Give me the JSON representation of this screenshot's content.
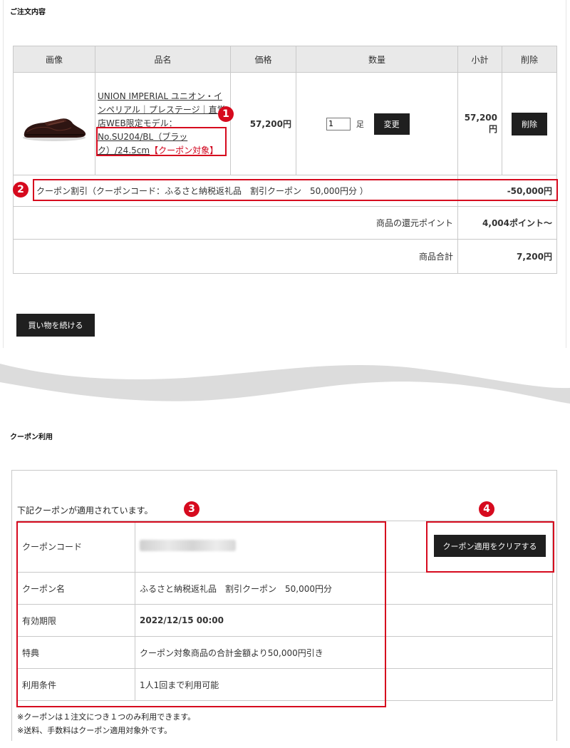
{
  "order_section": {
    "title": "ご注文内容",
    "headers": {
      "image": "画像",
      "name": "品名",
      "price": "価格",
      "qty": "数量",
      "subtotal": "小計",
      "delete": "削除"
    },
    "product": {
      "name_link": "UNION IMPERIAL ユニオン・インペリアル｜プレステージ｜直営店WEB限定モデル：No.SU204/BL（ブラック）/24.5cm",
      "coupon_tag": "【クーポン対象】",
      "price": "57,200円",
      "qty_value": "1",
      "qty_unit": "足",
      "change_button": "変更",
      "subtotal": "57,200円",
      "delete_button": "削除"
    },
    "coupon_row": {
      "label": "クーポン割引（クーポンコード：ふるさと納税返礼品　割引クーポン　50,000円分 ）",
      "amount": "-50,000円"
    },
    "points_row": {
      "label": "商品の還元ポイント",
      "value": "4,004ポイント〜"
    },
    "total_row": {
      "label": "商品合計",
      "value": "7,200円"
    },
    "continue_button": "買い物を続ける"
  },
  "coupon_section": {
    "title": "クーポン利用",
    "applied_text": "下記クーポンが適用されています。",
    "clear_button": "クーポン適用をクリアする",
    "rows": [
      {
        "label": "クーポンコード",
        "value": ""
      },
      {
        "label": "クーポン名",
        "value": "ふるさと納税返礼品　割引クーポン　50,000円分"
      },
      {
        "label": "有効期限",
        "value": "2022/12/15 00:00"
      },
      {
        "label": "特典",
        "value": "クーポン対象商品の合計金額より50,000円引き"
      },
      {
        "label": "利用条件",
        "value": "1人1回まで利用可能"
      }
    ],
    "notes": [
      "※クーポンは１注文につき１つのみ利用できます。",
      "※送料、手数料はクーポン適用対象外です。"
    ]
  },
  "annotations": {
    "b1": "1",
    "b2": "2",
    "b3": "3",
    "b4": "4"
  },
  "colors": {
    "accent_red": "#d60a1e",
    "button_dark": "#1f1f1f",
    "header_gray": "#e9e9e9"
  }
}
